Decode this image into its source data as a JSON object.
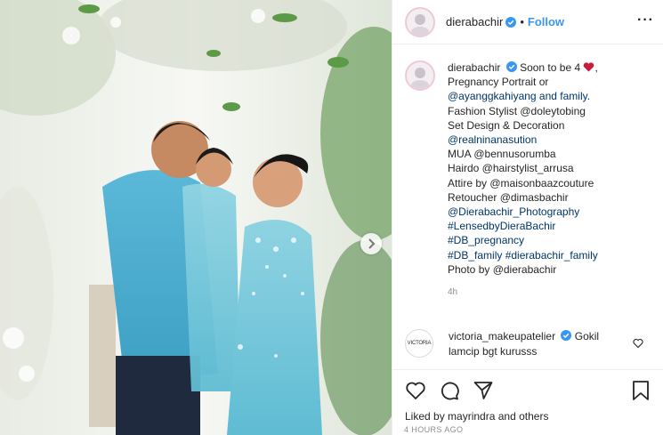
{
  "post": {
    "username": "dierabachir",
    "follow_label": "Follow",
    "dot": "•",
    "more_label": "···"
  },
  "caption": {
    "username": "dierabachir",
    "lines": [
      "Soon to be 4",
      "Pregnancy Portrait or",
      "@ayanggkahiyang and family.",
      "Fashion Stylist @doleytobing",
      "Set Design & Decoration",
      "@realninanasution",
      "MUA @bennusorumba",
      "Hairdo @hairstylist_arrusa",
      "Attire by @maisonbaazcouture",
      "Retoucher @dimasbachir",
      "@Dierabachir_Photography",
      "#LensedbyDieraBachir",
      "#DB_pregnancy",
      "#DB_family #dierabachir_family",
      "Photo by @dierabachir"
    ],
    "line1_tail": ",",
    "time": "4h"
  },
  "comment": {
    "avatar_text": "VICTORIA",
    "username": "victoria_makeupatelier",
    "text": "Gokil lamcip bgt kurusss"
  },
  "footer": {
    "liked_prefix": "Liked by",
    "liked_user": "mayrindra",
    "liked_suffix": "and others",
    "ago": "4 HOURS AGO"
  },
  "colors": {
    "accent": "#3897f0",
    "verified": "#3897f0",
    "mention": "#003569",
    "heart": "#ed4956",
    "dress": "#6fc3d6"
  },
  "icons": [
    "heart-icon",
    "comment-icon",
    "share-icon",
    "bookmark-icon",
    "verified-badge-icon",
    "next-arrow-icon",
    "more-options-icon"
  ]
}
